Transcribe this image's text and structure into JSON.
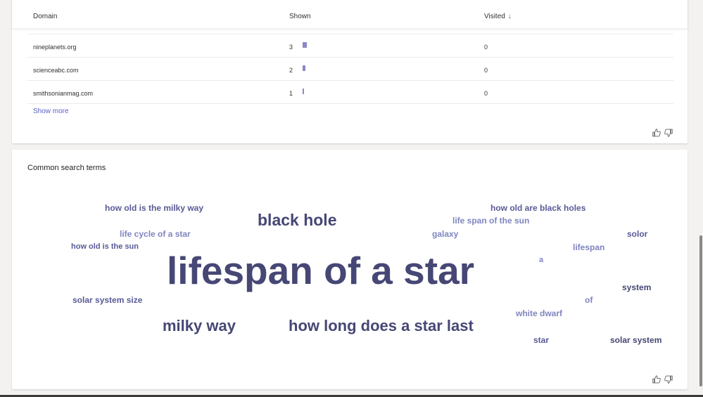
{
  "domains_table": {
    "columns": {
      "domain": "Domain",
      "shown": "Shown",
      "visited": "Visited"
    },
    "sort_icon": "arrow-down-icon",
    "rows": [
      {
        "domain": "nineplanets.org",
        "shown": "3",
        "visited": "0",
        "shown_fraction": 1.0
      },
      {
        "domain": "scienceabc.com",
        "shown": "2",
        "visited": "0",
        "shown_fraction": 0.67
      },
      {
        "domain": "smithsonianmag.com",
        "shown": "1",
        "visited": "0",
        "shown_fraction": 0.33
      }
    ],
    "show_more": "Show more",
    "feedback_icons": [
      "thumbs-up-icon",
      "thumbs-down-icon"
    ]
  },
  "search_terms": {
    "title": "Common search terms",
    "words": [
      {
        "text": "how old is the milky way",
        "tone": "mid"
      },
      {
        "text": "black hole",
        "tone": "dark"
      },
      {
        "text": "how old are black holes",
        "tone": "mid"
      },
      {
        "text": "life span of the sun",
        "tone": "light"
      },
      {
        "text": "life cycle of a star",
        "tone": "light"
      },
      {
        "text": "galaxy",
        "tone": "light"
      },
      {
        "text": "solor",
        "tone": "mid"
      },
      {
        "text": "how old is the sun",
        "tone": "mid"
      },
      {
        "text": "lifespan",
        "tone": "light"
      },
      {
        "text": "lifespan of a star",
        "tone": "dark"
      },
      {
        "text": "a",
        "tone": "light"
      },
      {
        "text": "system",
        "tone": "dark"
      },
      {
        "text": "solar system size",
        "tone": "mid"
      },
      {
        "text": "of",
        "tone": "light"
      },
      {
        "text": "white dwarf",
        "tone": "light"
      },
      {
        "text": "milky way",
        "tone": "dark"
      },
      {
        "text": "how long does a star last",
        "tone": "dark"
      },
      {
        "text": "star",
        "tone": "mid"
      },
      {
        "text": "solar system",
        "tone": "dark"
      }
    ],
    "feedback_icons": [
      "thumbs-up-icon",
      "thumbs-down-icon"
    ]
  },
  "colors": {
    "accent": "#5b5fc7",
    "bar": "#8a88c7",
    "word_dark": "#464775",
    "word_mid": "#585a96",
    "word_light": "#7f85c0"
  }
}
